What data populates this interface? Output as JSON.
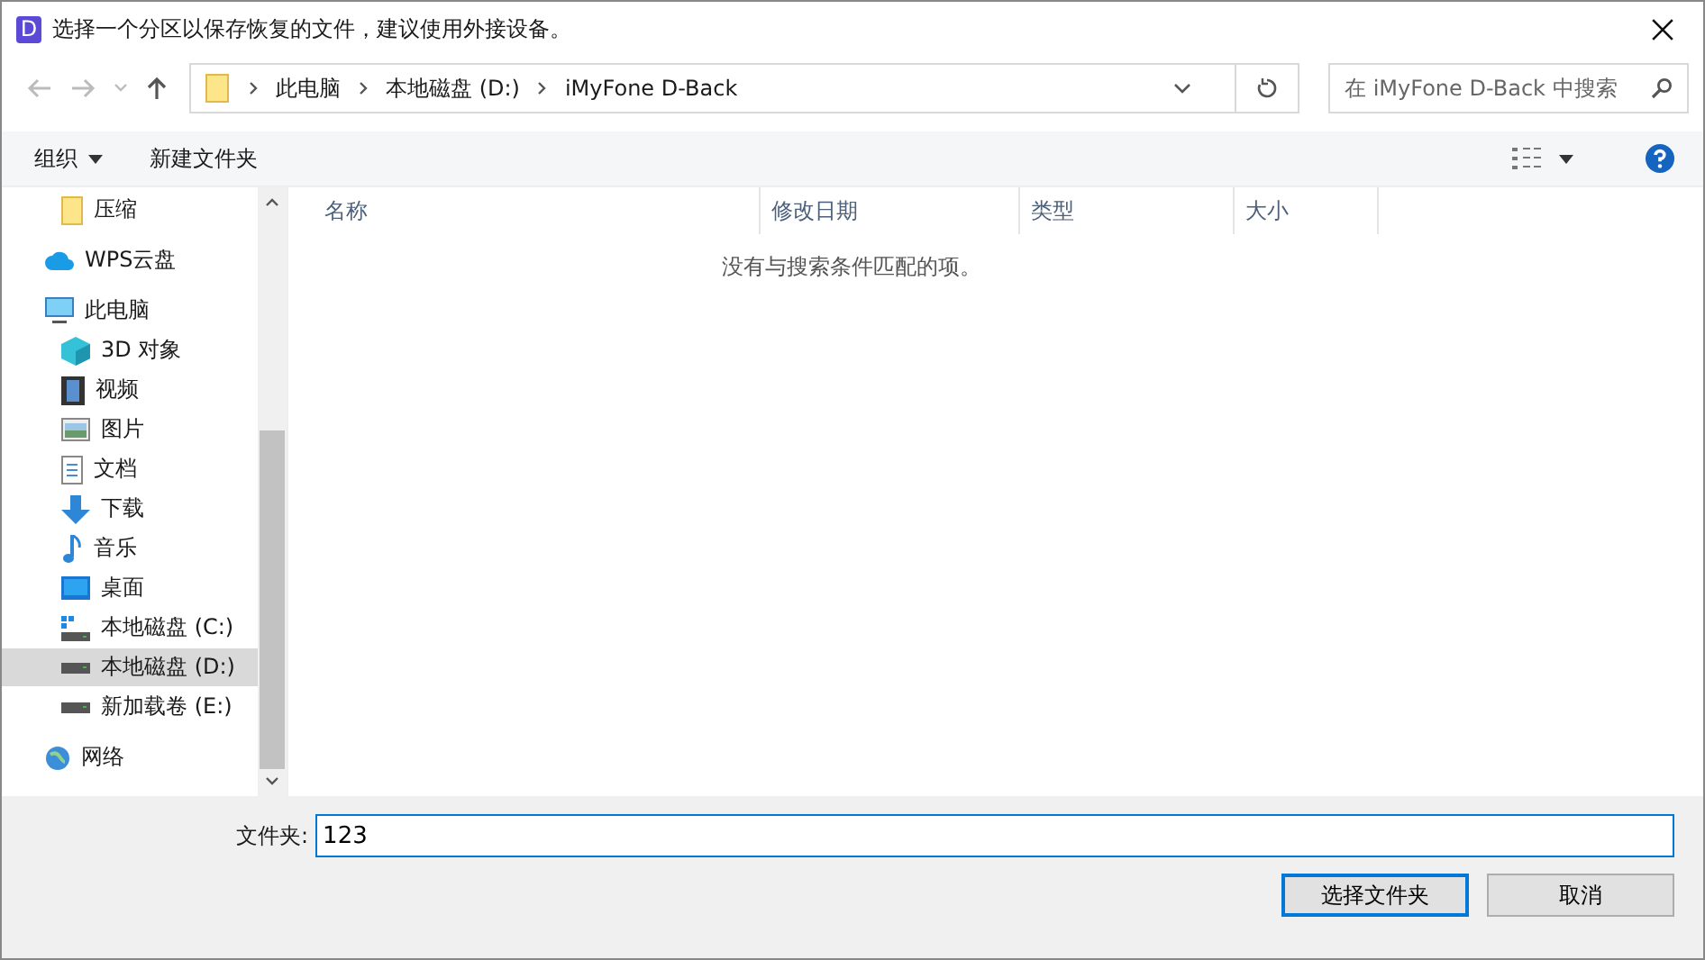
{
  "window": {
    "title": "选择一个分区以保存恢复的文件，建议使用外接设备。",
    "app_letter": "D"
  },
  "address": {
    "crumbs": [
      "此电脑",
      "本地磁盘 (D:)",
      "iMyFone D-Back"
    ]
  },
  "search": {
    "placeholder": "在 iMyFone D-Back 中搜索"
  },
  "toolbar": {
    "organize": "组织",
    "new_folder": "新建文件夹"
  },
  "sidebar": {
    "items": [
      {
        "label": "压缩",
        "kind": "folder",
        "selected": false
      },
      {
        "label": "WPS云盘",
        "kind": "cloud",
        "selected": false
      },
      {
        "label": "此电脑",
        "kind": "pc",
        "selected": false,
        "children": [
          {
            "label": "3D 对象",
            "kind": "cube",
            "selected": false
          },
          {
            "label": "视频",
            "kind": "video",
            "selected": false
          },
          {
            "label": "图片",
            "kind": "image",
            "selected": false
          },
          {
            "label": "文档",
            "kind": "doc",
            "selected": false
          },
          {
            "label": "下载",
            "kind": "download",
            "selected": false
          },
          {
            "label": "音乐",
            "kind": "music",
            "selected": false
          },
          {
            "label": "桌面",
            "kind": "desktop",
            "selected": false
          },
          {
            "label": "本地磁盘 (C:)",
            "kind": "sysdrive",
            "selected": false
          },
          {
            "label": "本地磁盘 (D:)",
            "kind": "drive",
            "selected": true
          },
          {
            "label": "新加载卷 (E:)",
            "kind": "drive",
            "selected": false
          }
        ]
      },
      {
        "label": "网络",
        "kind": "globe",
        "selected": false
      }
    ]
  },
  "table": {
    "columns": [
      "名称",
      "修改日期",
      "类型",
      "大小"
    ],
    "empty_message": "没有与搜索条件匹配的项。"
  },
  "folder_field": {
    "label": "文件夹:",
    "value": "123"
  },
  "buttons": [
    "选择文件夹",
    "取消"
  ]
}
